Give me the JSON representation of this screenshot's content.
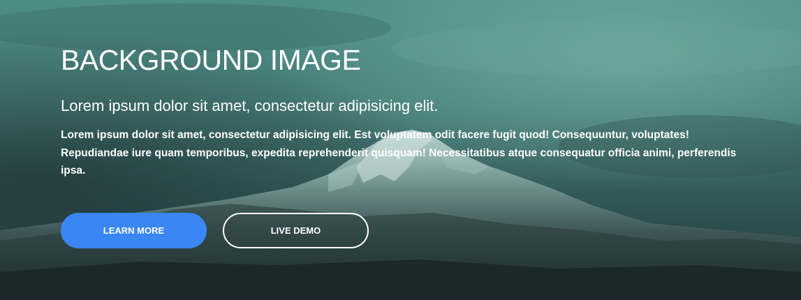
{
  "hero": {
    "title": "BACKGROUND IMAGE",
    "subtitle": "Lorem ipsum dolor sit amet, consectetur adipisicing elit.",
    "paragraph": "Lorem ipsum dolor sit amet, consectetur adipisicing elit. Est voluptatem odit facere fugit quod! Consequuntur, voluptates! Repudiandae iure quam temporibus, expedita reprehenderit quisquam! Necessitatibus atque consequatur officia animi, perferendis ipsa.",
    "buttons": {
      "learn_more": "LEARN MORE",
      "live_demo": "LIVE DEMO"
    }
  },
  "colors": {
    "primary_button": "#3a86f5",
    "text": "#ffffff",
    "background_tint": "#3f7470"
  }
}
